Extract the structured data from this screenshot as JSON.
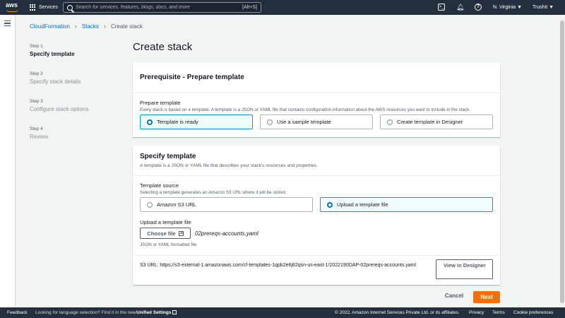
{
  "nav": {
    "logo": "aws",
    "services": "Services",
    "search_placeholder": "Search for services, features, blogs, docs, and more",
    "search_shortcut": "[Alt+S]",
    "region": "N. Virginia ▼",
    "user": "Trushit ▼"
  },
  "breadcrumb": {
    "item1": "CloudFormation",
    "item2": "Stacks",
    "current": "Create stack"
  },
  "steps": [
    {
      "num": "Step 1",
      "title": "Specify template"
    },
    {
      "num": "Step 2",
      "title": "Specify stack details"
    },
    {
      "num": "Step 3",
      "title": "Configure stack options"
    },
    {
      "num": "Step 4",
      "title": "Review"
    }
  ],
  "page_title": "Create stack",
  "prerequisite": {
    "header": "Prerequisite - Prepare template",
    "label": "Prepare template",
    "description": "Every stack is based on a template. A template is a JSON or YAML file that contains configuration information about the AWS resources you want to include in the stack.",
    "options": [
      "Template is ready",
      "Use a sample template",
      "Create template in Designer"
    ],
    "selected": "Template is ready"
  },
  "specify": {
    "header": "Specify template",
    "description": "A template is a JSON or YAML file that describes your stack's resources and properties.",
    "source_label": "Template source",
    "source_desc": "Selecting a template generates an Amazon S3 URL where it will be stored.",
    "source_options": [
      "Amazon S3 URL",
      "Upload a template file"
    ],
    "upload_label": "Upload a template file",
    "choose_file": "Choose file",
    "filename": "02prereqs-accounts.yaml",
    "upload_hint": "JSON or YAML formatted file",
    "s3_url": "S3 URL:  https://s3-external-1.amazonaws.com/cf-templates-1qpb2e6j82qsn-us-east-1/2022190DAP-02prereqs-accounts.yaml",
    "view_designer": "View in Designer"
  },
  "actions": {
    "cancel": "Cancel",
    "next": "Next"
  },
  "footer": {
    "feedback": "Feedback",
    "lang_prompt": "Looking for language selection? Find it in the new",
    "unified": "Unified Settings",
    "copyright": "© 2022, Amazon Internet Services Private Ltd. or its affiliates.",
    "privacy": "Privacy",
    "terms": "Terms",
    "cookies": "Cookie preferences"
  }
}
